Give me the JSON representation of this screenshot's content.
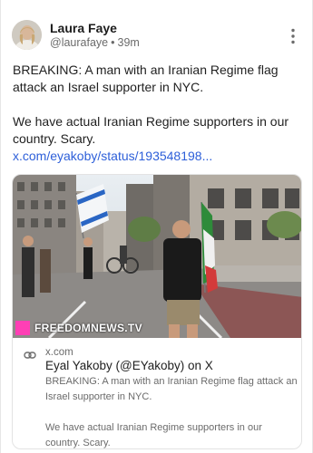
{
  "post": {
    "author": {
      "name": "Laura Faye",
      "handle": "@laurafaye",
      "separator": "•",
      "time": "39m"
    },
    "paragraphs": [
      "BREAKING: A man with an Iranian Regime flag attack an Israel supporter in NYC.",
      "We have actual Iranian Regime supporters in our country. Scary."
    ],
    "link_text": "x.com/eyakoby/status/193548198..."
  },
  "card": {
    "watermark": "FREEDOMNEWS.TV",
    "domain": "x.com",
    "title": "Eyal Yakoby (@EYakoby) on X",
    "desc": [
      "BREAKING: A man with an Iranian Regime flag attack an Israel supporter in NYC.",
      "We have actual Iranian Regime supporters in our country. Scary."
    ]
  },
  "icons": {
    "more": "more-vertical-icon",
    "link": "link-icon"
  },
  "colors": {
    "link": "#2d5fd9",
    "watermark_square": "#ff3fb5",
    "muted": "#6b6b6b"
  }
}
